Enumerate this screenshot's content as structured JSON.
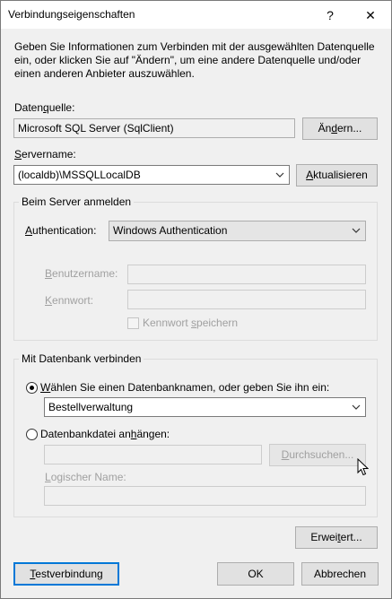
{
  "window": {
    "title": "Verbindungseigenschaften",
    "help_glyph": "?",
    "close_glyph": "✕"
  },
  "description": "Geben Sie Informationen zum Verbinden mit der ausgewählten Datenquelle ein, oder klicken Sie auf \"Ändern\", um eine andere Datenquelle und/oder einen anderen Anbieter auszuwählen.",
  "datasource": {
    "label_pre": "Daten",
    "label_mn": "q",
    "label_post": "uelle:",
    "value": "Microsoft SQL Server (SqlClient)",
    "change_pre": "Än",
    "change_mn": "d",
    "change_post": "ern..."
  },
  "server": {
    "label_pre": "",
    "label_mn": "S",
    "label_post": "ervername:",
    "value": "(localdb)\\MSSQLLocalDB",
    "refresh_pre": "",
    "refresh_mn": "A",
    "refresh_post": "ktualisieren"
  },
  "login_group": {
    "title": "Beim Server anmelden",
    "auth_pre": "",
    "auth_mn": "A",
    "auth_post": "uthentication:",
    "auth_value": "Windows Authentication",
    "user_pre": "",
    "user_mn": "B",
    "user_post": "enutzername:",
    "pass_pre": "",
    "pass_mn": "K",
    "pass_post": "ennwort:",
    "save_pre": "Kennwort ",
    "save_mn": "s",
    "save_post": "peichern"
  },
  "db_group": {
    "title": "Mit Datenbank verbinden",
    "radio1_pre": "",
    "radio1_mn": "W",
    "radio1_post": "ählen Sie einen Datenbanknamen, oder geben Sie ihn ein:",
    "db_value": "Bestellverwaltung",
    "radio2_pre": "Datenbankdatei an",
    "radio2_mn": "h",
    "radio2_post": "ängen:",
    "browse_pre": "",
    "browse_mn": "D",
    "browse_post": "urchsuchen...",
    "logical_pre": "",
    "logical_mn": "L",
    "logical_post": "ogischer Name:"
  },
  "advanced_pre": "Erwei",
  "advanced_mn": "t",
  "advanced_post": "ert...",
  "test_pre": "",
  "test_mn": "T",
  "test_post": "estverbindung",
  "ok_label": "OK",
  "cancel_label": "Abbrechen",
  "icons": {
    "help": "question-mark",
    "close": "x",
    "dropdown": "chevron-down",
    "cursor": "arrow-pointer"
  }
}
